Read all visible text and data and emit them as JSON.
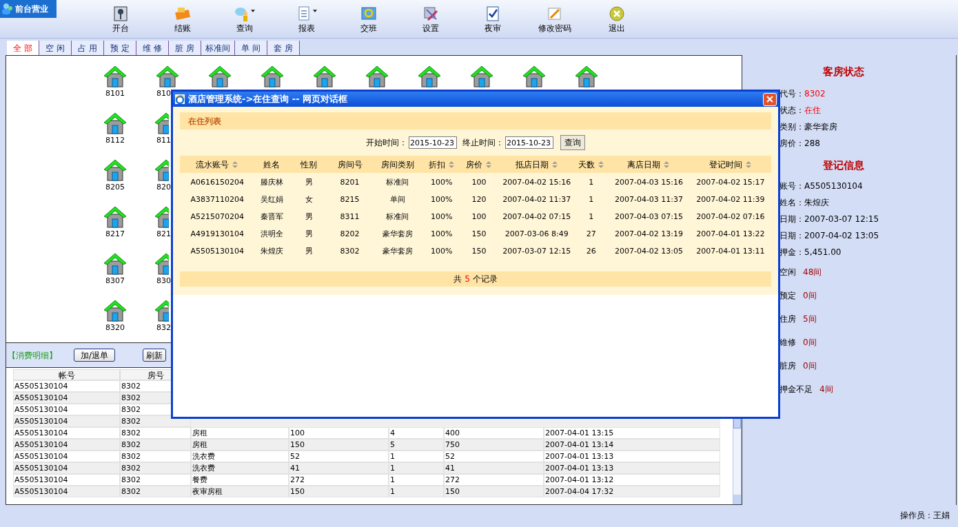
{
  "module_title": "前台营业",
  "toolbar": [
    {
      "label": "开台",
      "dropdown": false
    },
    {
      "label": "结账",
      "dropdown": false
    },
    {
      "label": "查询",
      "dropdown": true
    },
    {
      "label": "报表",
      "dropdown": true
    },
    {
      "label": "交班",
      "dropdown": false
    },
    {
      "label": "设置",
      "dropdown": false
    },
    {
      "label": "夜审",
      "dropdown": false
    },
    {
      "label": "修改密码",
      "dropdown": false
    },
    {
      "label": "退出",
      "dropdown": false
    }
  ],
  "tabs": [
    {
      "label": "全 部",
      "selected": true
    },
    {
      "label": "空 闲",
      "selected": false
    },
    {
      "label": "占 用",
      "selected": false
    },
    {
      "label": "预 定",
      "selected": false
    },
    {
      "label": "维 修",
      "selected": false
    },
    {
      "label": "脏 房",
      "selected": false
    },
    {
      "label": "标准间",
      "selected": false
    },
    {
      "label": "单 间",
      "selected": false
    },
    {
      "label": "套 房",
      "selected": false
    }
  ],
  "room_rows": [
    [
      {
        "label": "8101"
      },
      {
        "label": "810",
        "cut": true
      },
      {},
      {},
      {},
      {},
      {},
      {},
      {},
      {}
    ],
    [
      {
        "label": "8112"
      },
      {
        "label": "811",
        "cut": true
      }
    ],
    [
      {
        "label": "8205"
      },
      {
        "label": "820",
        "cut": true
      }
    ],
    [
      {
        "label": "8217"
      },
      {
        "label": "821",
        "cut": true
      }
    ],
    [
      {
        "label": "8307"
      },
      {
        "label": "830",
        "cut": true
      }
    ],
    [
      {
        "label": "8320"
      },
      {
        "label": "832",
        "cut": true
      }
    ]
  ],
  "consumption": {
    "title": "【消费明细】",
    "buttons": [
      "加/退单",
      "刷新"
    ],
    "columns": [
      "帐号",
      "房号"
    ],
    "rows": [
      [
        "A5505130104",
        "8302"
      ],
      [
        "A5505130104",
        "8302"
      ],
      [
        "A5505130104",
        "8302"
      ],
      [
        "A5505130104",
        "8302"
      ],
      [
        "A5505130104",
        "8302",
        "房租",
        "100",
        "4",
        "400",
        "2007-04-01 13:15"
      ],
      [
        "A5505130104",
        "8302",
        "房租",
        "150",
        "5",
        "750",
        "2007-04-01 13:14"
      ],
      [
        "A5505130104",
        "8302",
        "洗衣费",
        "52",
        "1",
        "52",
        "2007-04-01 13:13"
      ],
      [
        "A5505130104",
        "8302",
        "洗衣费",
        "41",
        "1",
        "41",
        "2007-04-01 13:13"
      ],
      [
        "A5505130104",
        "8302",
        "餐费",
        "272",
        "1",
        "272",
        "2007-04-01 13:12"
      ],
      [
        "A5505130104",
        "8302",
        "夜审房租",
        "150",
        "1",
        "150",
        "2007-04-04 17:32"
      ]
    ]
  },
  "side_panel": {
    "room_title": "客房状态",
    "room_fields": [
      {
        "label": "代号：",
        "value": "8302",
        "highlight": true
      },
      {
        "label": "状态：",
        "value": "在住",
        "highlight": true
      },
      {
        "label": "类别：",
        "value": "豪华套房",
        "highlight": false
      },
      {
        "label": "房价：",
        "value": "288",
        "highlight": false
      }
    ],
    "checkin_title": "登记信息",
    "checkin_fields": [
      {
        "label": "账号：",
        "value": "A5505130104"
      },
      {
        "label": "姓名：",
        "value": "朱煌庆"
      },
      {
        "label": "日期：",
        "value": "2007-03-07 12:15"
      },
      {
        "label": "日期：",
        "value": "2007-04-02 13:05"
      },
      {
        "label": "押金：",
        "value": "5,451.00"
      }
    ],
    "counts": [
      {
        "label": "空闲",
        "value": "48间"
      },
      {
        "label": "预定",
        "value": "0间"
      },
      {
        "label": "住房",
        "value": "5间"
      },
      {
        "label": "維修",
        "value": "0间"
      },
      {
        "label": "脏房",
        "value": "0间"
      },
      {
        "label": "押金不足",
        "value": "4间"
      }
    ]
  },
  "status_bar": "操作员：王娟",
  "dialog": {
    "title": "酒店管理系统->在住查询 -- 网页对话框",
    "section": "在住列表",
    "start_label": "开始时间：",
    "start_value": "2015-10-23",
    "end_label": "终止时间：",
    "end_value": "2015-10-23",
    "query_button": "查询",
    "columns": [
      {
        "label": "流水账号",
        "sortable": true
      },
      {
        "label": "姓名",
        "sortable": false
      },
      {
        "label": "性别",
        "sortable": false
      },
      {
        "label": "房间号",
        "sortable": false
      },
      {
        "label": "房间类别",
        "sortable": false
      },
      {
        "label": "折扣",
        "sortable": true
      },
      {
        "label": "房价",
        "sortable": true
      },
      {
        "label": "抵店日期",
        "sortable": true
      },
      {
        "label": "天数",
        "sortable": true
      },
      {
        "label": "离店日期",
        "sortable": true
      },
      {
        "label": "登记时间",
        "sortable": true
      }
    ],
    "rows": [
      [
        "A0616150204",
        "滕庆林",
        "男",
        "8201",
        "标准间",
        "100%",
        "100",
        "2007-04-02 15:16",
        "1",
        "2007-04-03 15:16",
        "2007-04-02 15:17"
      ],
      [
        "A3837110204",
        "吴红娟",
        "女",
        "8215",
        "单间",
        "100%",
        "120",
        "2007-04-02 11:37",
        "1",
        "2007-04-03 11:37",
        "2007-04-02 11:39"
      ],
      [
        "A5215070204",
        "秦晋军",
        "男",
        "8311",
        "标准间",
        "100%",
        "100",
        "2007-04-02 07:15",
        "1",
        "2007-04-03 07:15",
        "2007-04-02 07:16"
      ],
      [
        "A4919130104",
        "洪明全",
        "男",
        "8202",
        "豪华套房",
        "100%",
        "150",
        "2007-03-06 8:49",
        "27",
        "2007-04-02 13:19",
        "2007-04-01 13:22"
      ],
      [
        "A5505130104",
        "朱煌庆",
        "男",
        "8302",
        "豪华套房",
        "100%",
        "150",
        "2007-03-07 12:15",
        "26",
        "2007-04-02 13:05",
        "2007-04-01 13:11"
      ]
    ],
    "total_prefix": "共",
    "total_count": "5",
    "total_suffix": "个记录"
  }
}
